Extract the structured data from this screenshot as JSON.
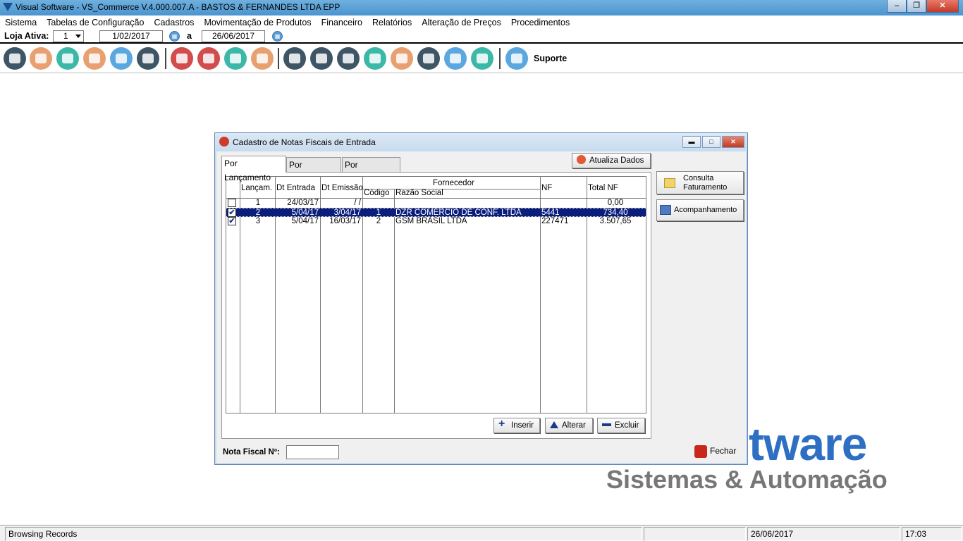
{
  "window": {
    "title": "Visual Software - VS_Commerce V.4.000.007.A - BASTOS & FERNANDES LTDA EPP"
  },
  "menu": [
    "Sistema",
    "Tabelas de Configuração",
    "Cadastros",
    "Movimentação de Produtos",
    "Financeiro",
    "Relatórios",
    "Alteração de Preços",
    "Procedimentos"
  ],
  "storebar": {
    "label": "Loja Ativa:",
    "store": "1",
    "date_from": "1/02/2017",
    "sep": "a",
    "date_to": "26/06/2017"
  },
  "toolbar": {
    "icons": [
      {
        "name": "user-icon",
        "color": "#3e5566"
      },
      {
        "name": "basket-icon",
        "color": "#e8a070"
      },
      {
        "name": "hand-truck-icon",
        "color": "#3cb8a8"
      },
      {
        "name": "delivery-truck-icon",
        "color": "#e8a070"
      },
      {
        "name": "credit-card-icon",
        "color": "#5ba7e0"
      },
      {
        "name": "layers-icon",
        "color": "#3e5566"
      },
      {
        "name": "price-tag-icon",
        "color": "#d24c4c"
      },
      {
        "name": "download-cloud-icon",
        "color": "#d24c4c"
      },
      {
        "name": "upload-cloud-icon",
        "color": "#3cb8a8"
      },
      {
        "name": "lifebuoy-icon",
        "color": "#e8a070"
      },
      {
        "name": "payment-terminal-icon",
        "color": "#3e5566"
      },
      {
        "name": "pie-chart-icon",
        "color": "#3e5566"
      },
      {
        "name": "calculator-icon",
        "color": "#3e5566"
      },
      {
        "name": "cash-icon",
        "color": "#3cb8a8"
      },
      {
        "name": "briefcase-icon",
        "color": "#e8a070"
      },
      {
        "name": "bar-chart-icon",
        "color": "#3e5566"
      },
      {
        "name": "books-icon",
        "color": "#5ba7e0"
      },
      {
        "name": "line-chart-icon",
        "color": "#3cb8a8"
      },
      {
        "name": "chat-bubble-icon",
        "color": "#5ba7e0"
      }
    ],
    "support_label": "Suporte"
  },
  "watermark": {
    "line1": "tware",
    "line2": "Sistemas & Automação"
  },
  "dialog": {
    "title": "Cadastro de Notas Fiscais de Entrada",
    "tabs": [
      "Por Lançamento",
      "Por Data/Hora",
      "Por Fornecedor"
    ],
    "refresh_label": "Atualiza Dados",
    "side_buttons": {
      "consulta": "Consulta\nFaturamento",
      "acompanhamento": "Acompanhamento"
    },
    "grid": {
      "headers": {
        "lancam": "Lançam.",
        "dt_entrada": "Dt Entrada",
        "dt_emissao": "Dt Emissão",
        "fornecedor": "Fornecedor",
        "codigo": "Código",
        "razao": "Razão Social",
        "nf": "NF",
        "total": "Total NF"
      },
      "rows": [
        {
          "checked": false,
          "selected": false,
          "lancam": "1",
          "dt_entrada": "24/03/17",
          "dt_emissao": "/ /",
          "codigo": "",
          "razao": "",
          "nf": "",
          "total": "0,00"
        },
        {
          "checked": true,
          "selected": true,
          "lancam": "2",
          "dt_entrada": "5/04/17",
          "dt_emissao": "3/04/17",
          "codigo": "1",
          "razao": "DZR COMERCIO DE CONF. LTDA",
          "nf": "5441",
          "total": "734,40"
        },
        {
          "checked": true,
          "selected": false,
          "lancam": "3",
          "dt_entrada": "5/04/17",
          "dt_emissao": "16/03/17",
          "codigo": "2",
          "razao": "GSM BRASIL LTDA",
          "nf": "227471",
          "total": "3.507,65"
        }
      ]
    },
    "buttons": {
      "insert": "Inserir",
      "edit": "Alterar",
      "delete": "Excluir"
    },
    "nf_label": "Nota Fiscal Nº:",
    "nf_value": "",
    "close_label": "Fechar"
  },
  "statusbar": {
    "message": "Browsing Records",
    "date": "26/06/2017",
    "time": "17:03"
  }
}
